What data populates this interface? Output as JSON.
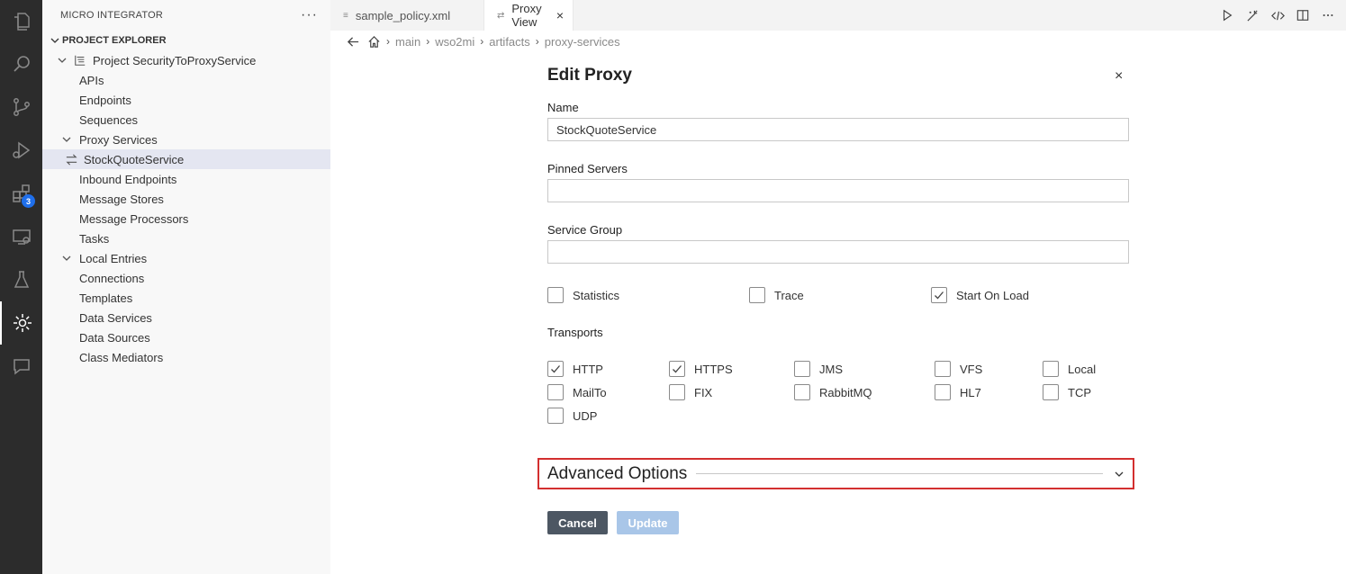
{
  "sidebar": {
    "title": "MICRO INTEGRATOR",
    "more": "···",
    "section": "PROJECT EXPLORER",
    "project": "Project SecurityToProxyService",
    "items": {
      "apis": "APIs",
      "endpoints": "Endpoints",
      "sequences": "Sequences",
      "proxy_services": "Proxy Services",
      "stockquote": "StockQuoteService",
      "inbound": "Inbound Endpoints",
      "message_stores": "Message Stores",
      "message_processors": "Message Processors",
      "tasks": "Tasks",
      "local_entries": "Local Entries",
      "connections": "Connections",
      "templates": "Templates",
      "data_services": "Data Services",
      "data_sources": "Data Sources",
      "class_mediators": "Class Mediators"
    }
  },
  "activity": {
    "badge": "3"
  },
  "tabs": [
    {
      "label": "sample_policy.xml",
      "icon": "≡"
    },
    {
      "label": "Proxy View",
      "icon": "⇄",
      "close": "×"
    }
  ],
  "breadcrumb": {
    "main": "main",
    "wso2mi": "wso2mi",
    "artifacts": "artifacts",
    "proxy_services": "proxy-services"
  },
  "form": {
    "title": "Edit Proxy",
    "close": "×",
    "name_label": "Name",
    "name_value": "StockQuoteService",
    "pinned_label": "Pinned Servers",
    "pinned_value": "",
    "group_label": "Service Group",
    "group_value": "",
    "options": {
      "statistics": "Statistics",
      "trace": "Trace",
      "start_on_load": "Start On Load"
    },
    "options_checked": {
      "statistics": false,
      "trace": false,
      "start_on_load": true
    },
    "transports_label": "Transports",
    "transports": {
      "http": "HTTP",
      "https": "HTTPS",
      "jms": "JMS",
      "vfs": "VFS",
      "local": "Local",
      "mailto": "MailTo",
      "fix": "FIX",
      "rabbitmq": "RabbitMQ",
      "hl7": "HL7",
      "tcp": "TCP",
      "udp": "UDP"
    },
    "transports_checked": {
      "http": true,
      "https": true
    },
    "advanced": "Advanced Options",
    "cancel": "Cancel",
    "update": "Update"
  },
  "colors": {
    "activity_bg": "#2c2c2c",
    "badge": "#1f6feb",
    "highlight_border": "#d32f2f",
    "cancel_bg": "#4d5763",
    "update_bg": "#a9c6e8"
  }
}
